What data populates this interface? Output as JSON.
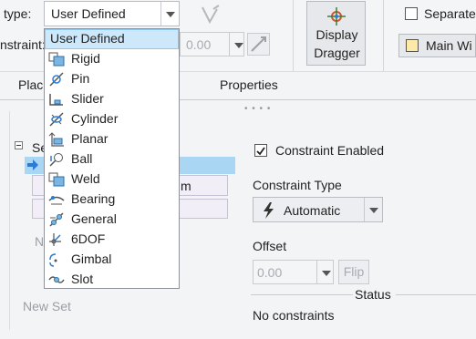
{
  "ribbon": {
    "type_label": "type:",
    "type_value": "User Defined",
    "constraint_label": "nstraint:",
    "constraint_value": "0.00",
    "display_dragger": [
      "Display",
      "Dragger"
    ],
    "separate_label": "Separate",
    "main_window_label": "Main Wi"
  },
  "tabs": {
    "placement": "Plac",
    "properties": "Properties"
  },
  "left_panel": {
    "set_label": "Se",
    "row1_tail": "m",
    "new_prefix": "N",
    "new_set": "New Set"
  },
  "right_panel": {
    "constraint_enabled": "Constraint Enabled",
    "constraint_type_label": "Constraint Type",
    "constraint_type_value": "Automatic",
    "offset_label": "Offset",
    "offset_value": "0.00",
    "flip_label": "Flip",
    "status_label": "Status",
    "status_value": "No constraints"
  },
  "dropdown": {
    "selected": "User Defined",
    "items": [
      {
        "label": "User Defined",
        "icon": "none"
      },
      {
        "label": "Rigid",
        "icon": "rigid-icon"
      },
      {
        "label": "Pin",
        "icon": "pin-icon"
      },
      {
        "label": "Slider",
        "icon": "slider-icon"
      },
      {
        "label": "Cylinder",
        "icon": "cylinder-icon"
      },
      {
        "label": "Planar",
        "icon": "planar-icon"
      },
      {
        "label": "Ball",
        "icon": "ball-icon"
      },
      {
        "label": "Weld",
        "icon": "weld-icon"
      },
      {
        "label": "Bearing",
        "icon": "bearing-icon"
      },
      {
        "label": "General",
        "icon": "general-icon"
      },
      {
        "label": "6DOF",
        "icon": "six-dof-icon"
      },
      {
        "label": "Gimbal",
        "icon": "gimbal-icon"
      },
      {
        "label": "Slot",
        "icon": "slot-icon"
      }
    ]
  },
  "colors": {
    "selection": "#cde8fb",
    "list_highlight": "#a9d6f2",
    "accent_blue": "#2b7bd6"
  }
}
